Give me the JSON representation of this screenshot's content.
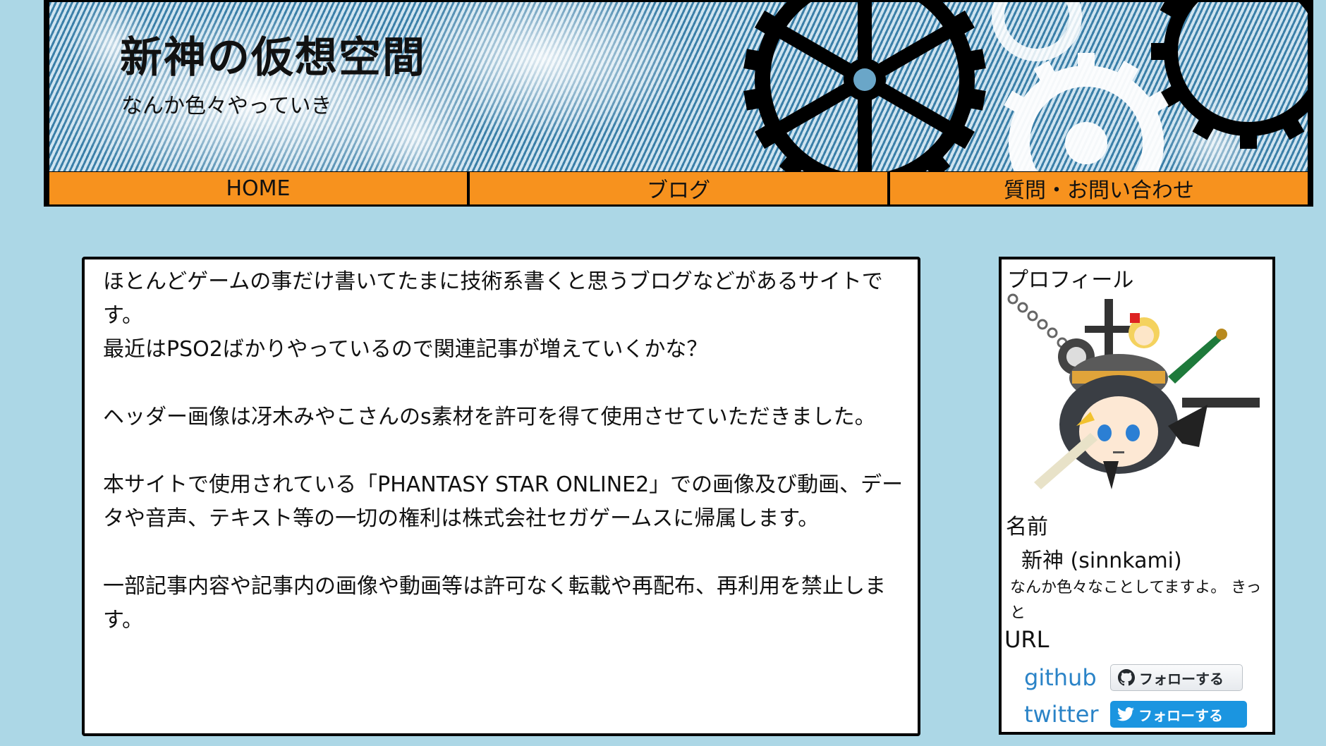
{
  "header": {
    "title": "新神の仮想空間",
    "subtitle": "なんか色々やっていき"
  },
  "nav": {
    "items": [
      {
        "label": "HOME"
      },
      {
        "label": "ブログ"
      },
      {
        "label": "質問・お問い合わせ"
      }
    ]
  },
  "main": {
    "paragraphs": [
      "ほとんどゲームの事だけ書いてたまに技術系書くと思うブログなどがあるサイトです。",
      "最近はPSO2ばかりやっているので関連記事が増えていくかな？",
      "ヘッダー画像は冴木みやこさんのs素材を許可を得て使用させていただきました。",
      "本サイトで使用されている「PHANTASY STAR ONLINE2」での画像及び動画、データや音声、テキスト等の一切の権利は株式会社セガゲームスに帰属します。",
      "一部記事内容や記事内の画像や動画等は許可なく転載や再配布、再利用を禁止します。"
    ]
  },
  "profile": {
    "title": "プロフィール",
    "name_label": "名前",
    "name": "新神 (sinnkami)",
    "bio": "なんか色々なことしてますよ。 きっと",
    "url_label": "URL",
    "github_label": "github",
    "twitter_label": "twitter",
    "github_button": "フォローする",
    "twitter_button": "フォローする"
  },
  "colors": {
    "page_background": "#acd7e6",
    "nav_background": "#f7921e",
    "link": "#2a83c7",
    "twitter_button": "#1b95e0"
  },
  "icons": [
    "gear-icon",
    "github-icon",
    "twitter-bird-icon"
  ]
}
